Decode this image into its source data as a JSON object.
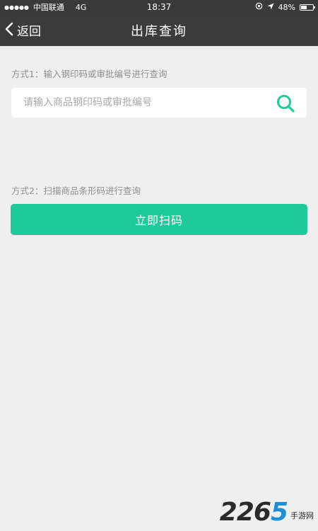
{
  "status_bar": {
    "signal": "●●●●●",
    "carrier": "中国联通",
    "network": "4G",
    "time": "18:37",
    "battery_text": "48%",
    "battery_level": 0.48
  },
  "nav": {
    "back_label": "返回",
    "title": "出库查询"
  },
  "method1": {
    "label": "方式1：输入钢印码或审批编号进行查询",
    "search_placeholder": "请输入商品钢印码或审批编号",
    "search_value": ""
  },
  "method2": {
    "label": "方式2：扫描商品条形码进行查询",
    "button_label": "立即扫码"
  },
  "watermark": {
    "number_prefix": "226",
    "number_accent": "5",
    "site_text": "手游网"
  },
  "colors": {
    "accent": "#1ecb98",
    "nav_background": "#3b3b3b",
    "page_background": "#efefef"
  }
}
